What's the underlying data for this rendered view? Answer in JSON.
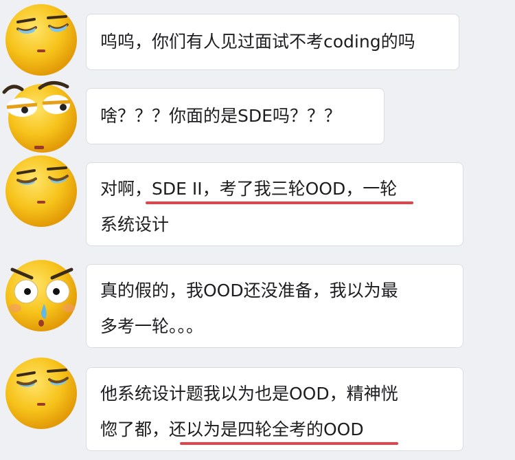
{
  "chat": {
    "messages": [
      {
        "avatar": "squinting-emoji",
        "lines": [
          "呜呜，你们有人见过面试不考coding的吗"
        ]
      },
      {
        "avatar": "skeptical-emoji",
        "lines": [
          "啥？？？你面的是SDE吗？？？"
        ]
      },
      {
        "avatar": "squinting-emoji",
        "lines": [
          "对啊，SDE II，考了我三轮OOD，一轮",
          "系统设计"
        ],
        "underlined": "SDE II，考了我三轮OOD，一轮"
      },
      {
        "avatar": "shocked-sweating-emoji",
        "lines": [
          "真的假的，我OOD还没准备，我以为最",
          "多考一轮。。。"
        ]
      },
      {
        "avatar": "squinting-emoji",
        "lines": [
          "他系统设计题我以为也是OOD，精神恍",
          "惚了都，还以为是四轮全考的OOD"
        ],
        "underlined": "还以为是四轮全考的OOD"
      }
    ]
  },
  "colors": {
    "background": "#eef0f3",
    "bubble": "#ffffff",
    "underline": "#e1444b",
    "emoji_face": "#f7c31b"
  }
}
